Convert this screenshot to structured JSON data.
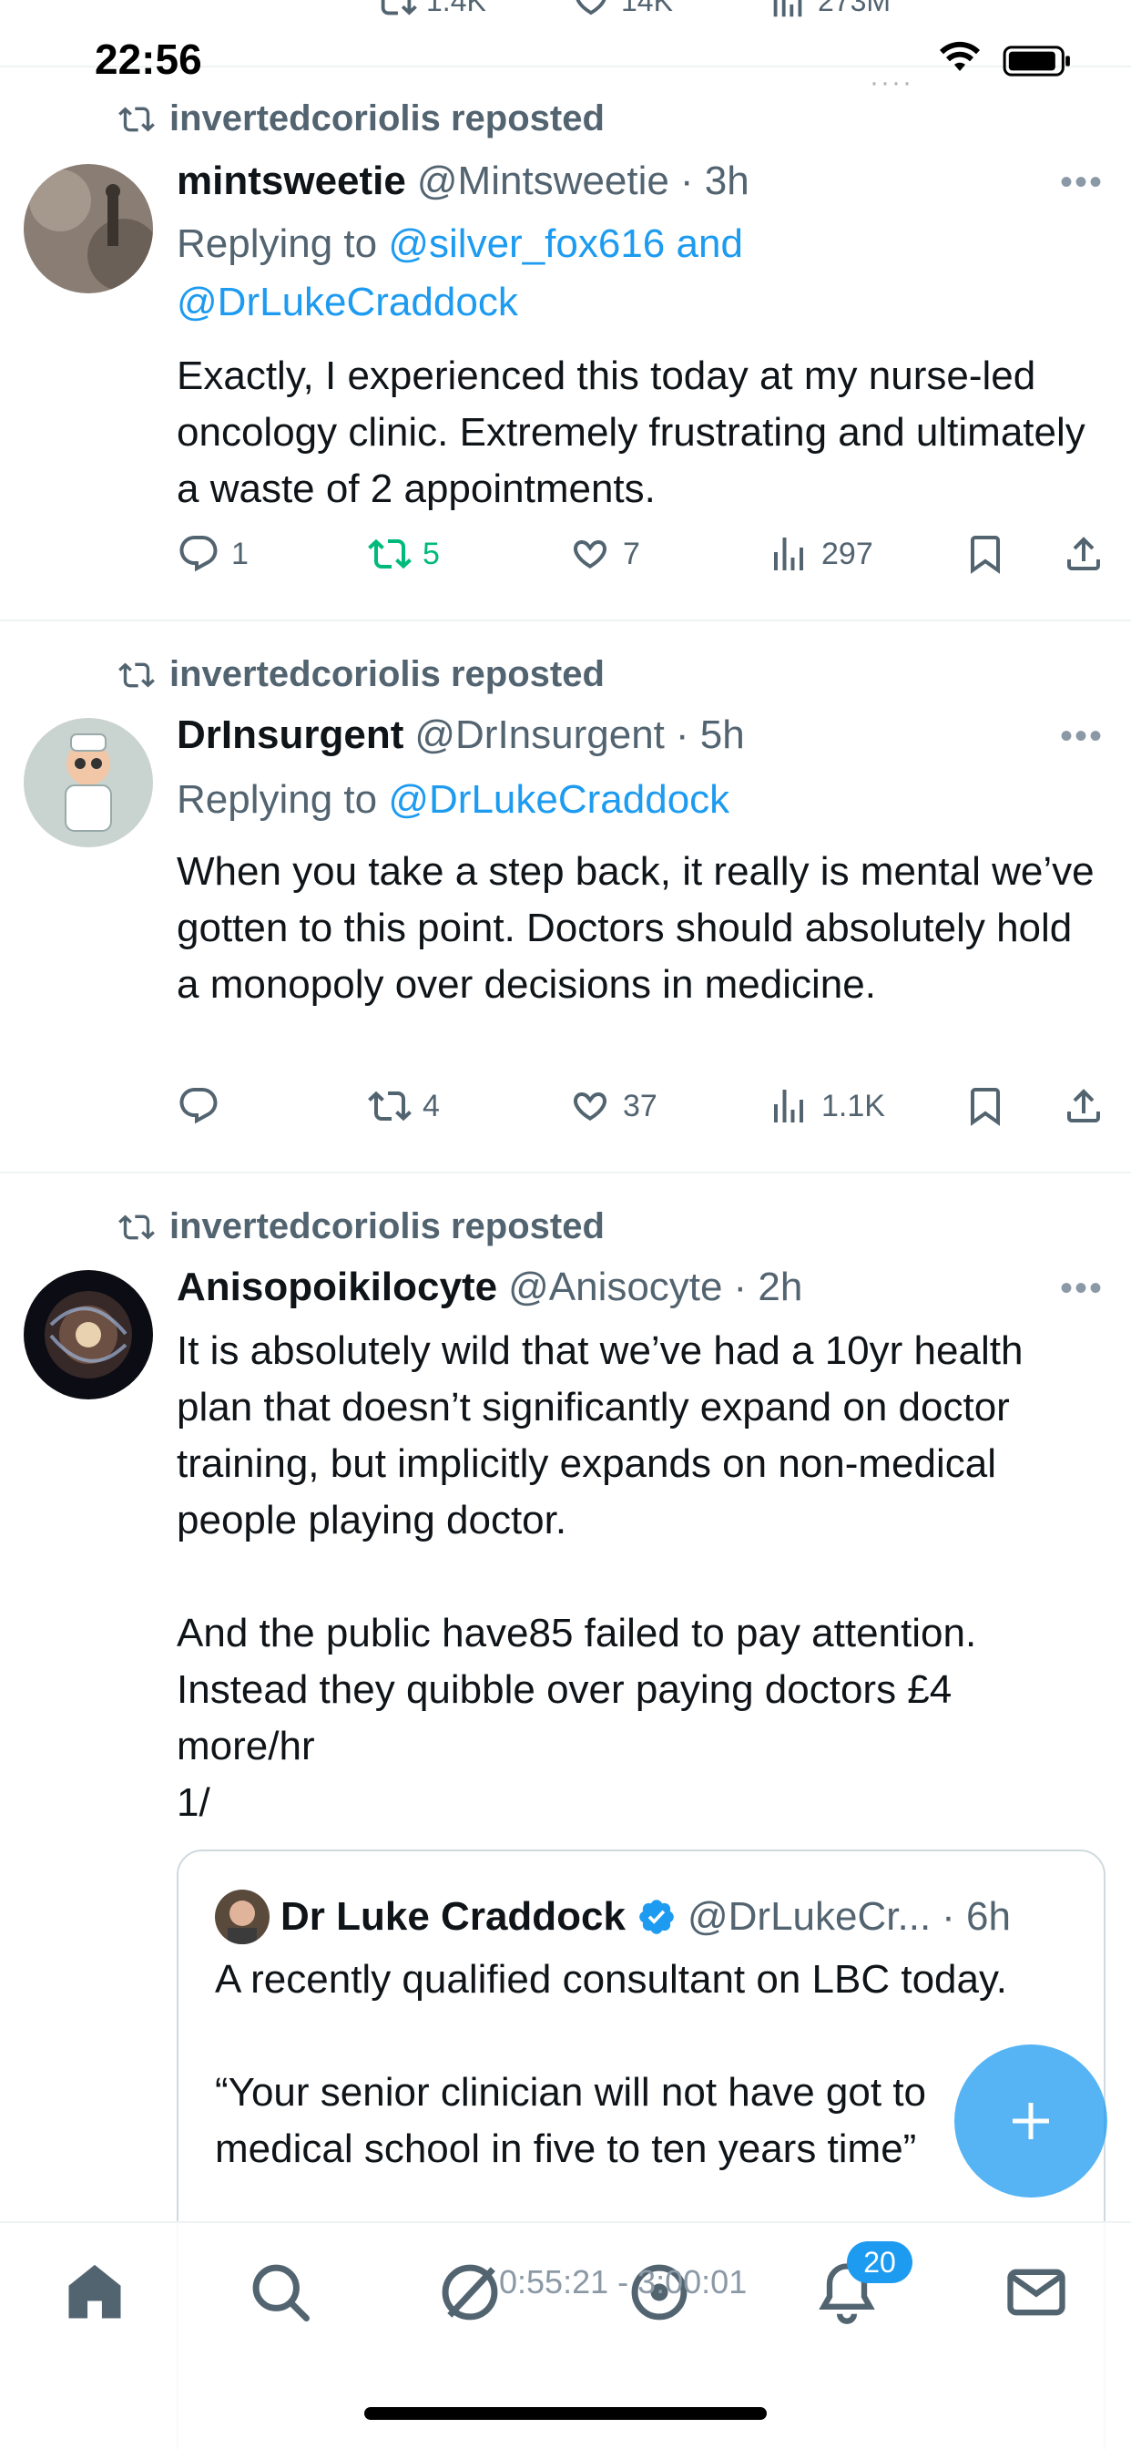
{
  "status_bar": {
    "time": "22:56",
    "signal_dots": "····"
  },
  "top_partial_actions": {
    "reposts": "1.4K",
    "likes": "14K",
    "views": "273M"
  },
  "tweets": [
    {
      "repost_label": "invertedcoriolis reposted",
      "name": "mintsweetie",
      "handle": "@Mintsweetie",
      "time": "· 3h",
      "reply_prefix": "Replying to ",
      "reply_links": "@silver_fox616 and @DrLukeCraddock",
      "text": "Exactly, I experienced this today at my nurse-led oncology clinic. Extremely frustrating and ultimately a waste of 2 appointments.",
      "replies": "1",
      "reposts": "5",
      "likes": "7",
      "views": "297"
    },
    {
      "repost_label": "invertedcoriolis reposted",
      "name": "DrInsurgent",
      "handle": "@DrInsurgent",
      "time": "· 5h",
      "reply_prefix": "Replying to ",
      "reply_links": "@DrLukeCraddock",
      "text": "When you take a step back, it really is mental we’ve gotten to this point. Doctors should absolutely hold a monopoly over decisions in medicine.",
      "replies": "",
      "reposts": "4",
      "likes": "37",
      "views": "1.1K"
    },
    {
      "repost_label": "invertedcoriolis reposted",
      "name": "Anisopoikilocyte",
      "handle": "@Anisocyte",
      "time": "· 2h",
      "text": "It is absolutely wild that we’ve had a 10yr health plan that doesn’t significantly expand on doctor training, but implicitly expands on non-medical people playing doctor.\n\nAnd the public have85  failed to pay attention. Instead they quibble over paying doctors £4 more/hr\n1/",
      "quote": {
        "name": "Dr Luke Craddock",
        "handle": "@DrLukeCr...",
        "time": "· 6h",
        "text": "A recently qualified consultant on LBC today.\n\n“Your senior clinician will not have got to medical school in five to ten years time”"
      }
    }
  ],
  "tabbar": {
    "timer_text": "0:55:21 - 3:00:01",
    "notifications_badge": "20"
  },
  "colors": {
    "accent": "#1d9bf0",
    "repost_green": "#00ba7c",
    "muted": "#536471"
  }
}
